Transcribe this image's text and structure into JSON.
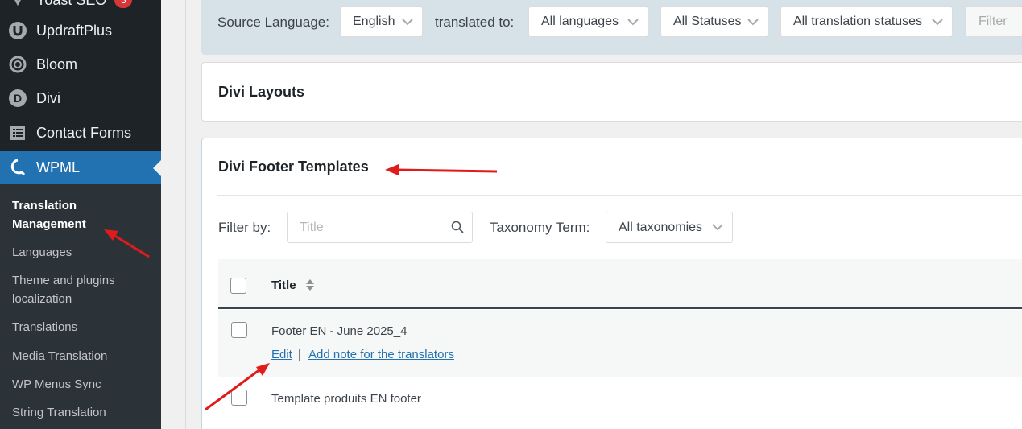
{
  "sidebar": {
    "items": [
      {
        "label": "Yoast SEO",
        "icon": "yoast-icon",
        "badge": "3"
      },
      {
        "label": "UpdraftPlus",
        "icon": "updraftplus-icon"
      },
      {
        "label": "Bloom",
        "icon": "bloom-icon"
      },
      {
        "label": "Divi",
        "icon": "divi-icon"
      },
      {
        "label": "Contact Forms",
        "icon": "contact-forms-icon"
      },
      {
        "label": "WPML",
        "icon": "wpml-icon"
      }
    ],
    "submenu": [
      {
        "label": "Translation Management"
      },
      {
        "label": "Languages"
      },
      {
        "label": "Theme and plugins localization"
      },
      {
        "label": "Translations"
      },
      {
        "label": "Media Translation"
      },
      {
        "label": "WP Menus Sync"
      },
      {
        "label": "String Translation"
      }
    ]
  },
  "filterbar": {
    "source_label": "Source Language:",
    "source_value": "English",
    "translated_label": "translated to:",
    "languages_value": "All languages",
    "statuses_value": "All Statuses",
    "translation_statuses_value": "All translation statuses",
    "filter_button": "Filter"
  },
  "sections": {
    "divi_layouts": "Divi Layouts",
    "divi_footer": "Divi Footer Templates"
  },
  "footer_filters": {
    "filter_by_label": "Filter by:",
    "search_placeholder": "Title",
    "taxonomy_label": "Taxonomy Term:",
    "taxonomy_value": "All taxonomies"
  },
  "table": {
    "header_title": "Title",
    "rows": [
      {
        "title": "Footer EN - June 2025_4",
        "edit": "Edit",
        "separator": "|",
        "note": "Add note for the translators"
      },
      {
        "title": "Template produits EN footer"
      }
    ]
  },
  "colors": {
    "sidebar_bg": "#1d2327",
    "submenu_bg": "#2c3338",
    "active_bg": "#2271b1",
    "filterbar_bg": "#d7e2e8",
    "link": "#2271b1",
    "annotation": "#e01b1b"
  }
}
